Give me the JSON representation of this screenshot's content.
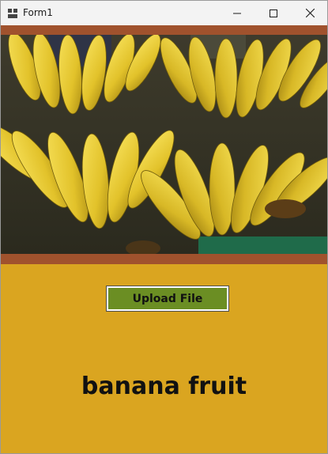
{
  "window": {
    "title": "Form1",
    "icons": {
      "app": "form-app-icon",
      "minimize": "minimize-icon",
      "maximize": "maximize-icon",
      "close": "close-icon"
    }
  },
  "colors": {
    "form_background": "#DAA520",
    "band": "#A0522D",
    "button_background": "#6B8E23",
    "button_border": "#FFFFFF"
  },
  "picture": {
    "content": "banana bunches photo"
  },
  "upload": {
    "label": "Upload File"
  },
  "result": {
    "text": "banana fruit"
  }
}
